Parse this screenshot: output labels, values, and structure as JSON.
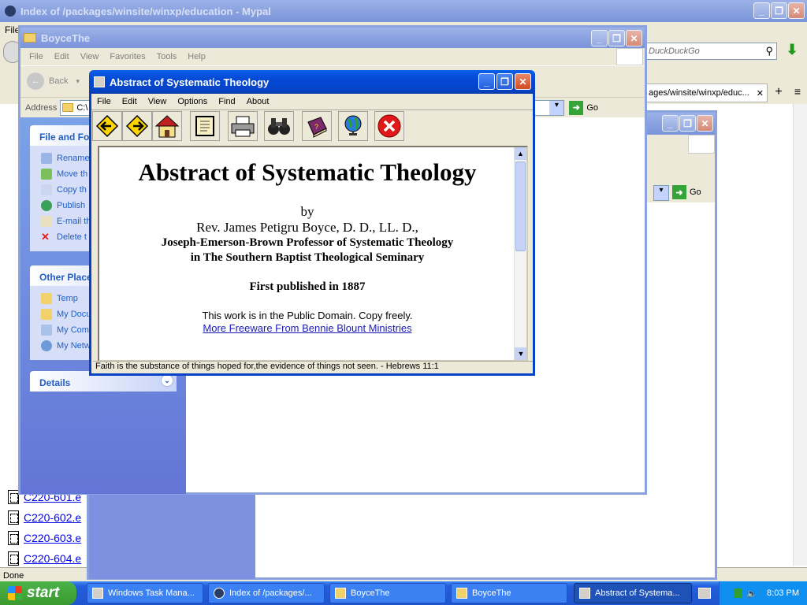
{
  "browser": {
    "title": "Index of /packages/winsite/winxp/education - Mypal",
    "menu_fragment": "File",
    "search_placeholder": "DuckDuckGo",
    "tab_title": "ages/winsite/winxp/educ...",
    "status": "Done",
    "files": [
      "C220-601.e",
      "C220-602.e",
      "C220-603.e",
      "C220-604.e"
    ]
  },
  "explorer": {
    "title": "BoyceThe",
    "menu": [
      "File",
      "Edit",
      "View",
      "Favorites",
      "Tools",
      "Help"
    ],
    "back_label": "Back",
    "address_label": "Address",
    "address_value": "C:\\",
    "go_label": "Go",
    "file_tasks_title": "File and Fo",
    "file_tasks": [
      "Rename",
      "Move th",
      "Copy th",
      "Publish",
      "E-mail th",
      "Delete t"
    ],
    "other_places_title": "Other Place",
    "other_places": [
      "Temp",
      "My Docu",
      "My Com",
      "My Netw"
    ],
    "details_title": "Details"
  },
  "explorer2": {
    "go_label": "Go"
  },
  "app": {
    "title": "Abstract of Systematic Theology",
    "menu": [
      "File",
      "Edit",
      "View",
      "Options",
      "Find",
      "About"
    ],
    "toolbar_icons": [
      "back-arrow-icon",
      "forward-arrow-icon",
      "home-icon",
      "book-icon",
      "printer-icon",
      "binoculars-icon",
      "bible-icon",
      "globe-icon",
      "close-circle-icon"
    ],
    "content": {
      "heading": "Abstract of Systematic Theology",
      "by": "by",
      "author": "Rev. James Petigru Boyce, D. D., LL. D.,",
      "position1": "Joseph-Emerson-Brown Professor of Systematic Theology",
      "position2": "in The Southern Baptist Theological Seminary",
      "published": "First published in 1887",
      "domain": "This work is in the Public Domain. Copy freely.",
      "link": "More Freeware From Bennie Blount Ministries"
    },
    "status": "Faith is the substance of things hoped for,the evidence of things not seen. - Hebrews 11:1"
  },
  "taskbar": {
    "start": "start",
    "tasks": [
      "Windows Task Mana...",
      "Index of /packages/...",
      "BoyceThe",
      "BoyceThe",
      "Abstract of Systema..."
    ],
    "clock": "8:03 PM"
  },
  "colors": {
    "accent": "#0a5fe8",
    "taskbar": "#245edb",
    "start": "#3c9a2e"
  }
}
